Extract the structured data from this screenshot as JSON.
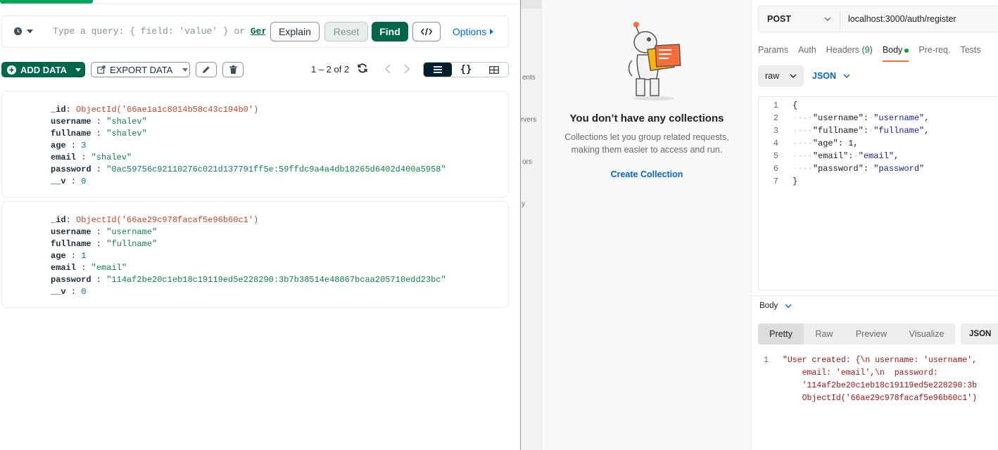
{
  "compass": {
    "query_bar": {
      "placeholder": "Type a query: { field: 'value' } or",
      "generate_link": "Ger",
      "explain_label": "Explain",
      "reset_label": "Reset",
      "find_label": "Find",
      "options_label": "Options"
    },
    "toolbar": {
      "add_data_label": "ADD DATA",
      "export_data_label": "EXPORT DATA",
      "pagination": "1 – 2 of 2"
    },
    "documents": [
      {
        "id_value": "ObjectId('66ae1a1c8014b58c43c194b0')",
        "username": "\"shalev\"",
        "fullname": "\"shalev\"",
        "age": "3",
        "email": "\"shalev\"",
        "password": "\"0ac59756c92110276c021d137791ff5e:59ffdc9a4a4db18265d6402d400a5958\"",
        "v": "0"
      },
      {
        "id_value": "ObjectId('66ae29c978facaf5e96b60c1')",
        "username": "\"username\"",
        "fullname": "\"fullname\"",
        "age": "1",
        "email": "\"email\"",
        "password": "\"114af2be20c1eb18c19119ed5e228290:3b7b38514e48867bcaa205710edd23bc\"",
        "v": "0"
      }
    ],
    "field_names": {
      "id": "_id",
      "username": "username",
      "fullname": "fullname",
      "age": "age",
      "email": "email",
      "password": "password",
      "v": "__v"
    },
    "colors": {
      "accent": "#00684a",
      "oid": "#c4472b",
      "string": "#12824d",
      "number": "#016bf8"
    }
  },
  "postman": {
    "rail_labels": [
      "ents",
      "rvers",
      "ors",
      "y"
    ],
    "collections": {
      "title": "You don’t have any collections",
      "description": "Collections let you group related requests, making them easier to access and run.",
      "create_link": "Create Collection"
    },
    "request": {
      "method": "POST",
      "url": "localhost:3000/auth/register",
      "tabs": {
        "params": "Params",
        "auth": "Auth",
        "headers": "Headers",
        "headers_count": "(9)",
        "body": "Body",
        "prereq": "Pre-req.",
        "tests": "Tests"
      },
      "body_mode": "raw",
      "body_lang": "JSON",
      "body_lines": [
        {
          "n": "1",
          "text": "{"
        },
        {
          "n": "2",
          "key": "\"username\"",
          "val": "\"username\","
        },
        {
          "n": "3",
          "key": "\"fullname\"",
          "val": "\"fullname\","
        },
        {
          "n": "4",
          "key": "\"age\"",
          "val": "1,"
        },
        {
          "n": "5",
          "key": "\"email\"",
          "val": "\"email\","
        },
        {
          "n": "6",
          "key": "\"password\"",
          "val": "\"password\""
        },
        {
          "n": "7",
          "text": "}"
        }
      ]
    },
    "response": {
      "label": "Body",
      "tabs": {
        "pretty": "Pretty",
        "raw": "Raw",
        "preview": "Preview",
        "visualize": "Visualize"
      },
      "lang": "JSON",
      "line_no": "1",
      "lines": [
        "\"User created: {\\n  username: 'username',",
        "    email: 'email',\\n  password:",
        "    '114af2be20c1eb18c19119ed5e228290:3b",
        "    ObjectId('66ae29c978facaf5e96b60c1')"
      ]
    }
  }
}
